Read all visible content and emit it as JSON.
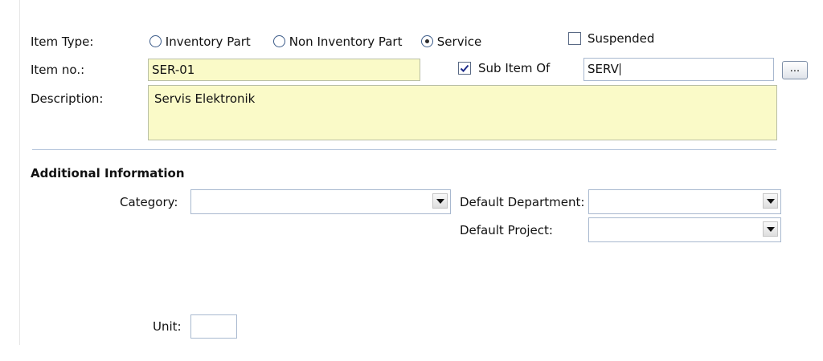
{
  "item_type": {
    "label": "Item Type:",
    "options": [
      {
        "label": "Inventory Part",
        "selected": false
      },
      {
        "label": "Non Inventory Part",
        "selected": false
      },
      {
        "label": "Service",
        "selected": true
      }
    ]
  },
  "suspended": {
    "label": "Suspended",
    "checked": false
  },
  "item_no": {
    "label": "Item no.:",
    "value": "SER-01"
  },
  "sub_item_of": {
    "label": "Sub Item Of",
    "checked": true,
    "value": "SERV",
    "browse_label": "..."
  },
  "description": {
    "label": "Description:",
    "value": "Servis Elektronik"
  },
  "additional_info": {
    "title": "Additional Information",
    "category": {
      "label": "Category:",
      "value": ""
    },
    "default_department": {
      "label": "Default Department:",
      "value": ""
    },
    "default_project": {
      "label": "Default Project:",
      "value": ""
    },
    "unit": {
      "label": "Unit:",
      "value": ""
    }
  },
  "colors": {
    "required_field_bg": "#fafac8",
    "field_border": "#a8b8cf",
    "separator": "#b7c6dc"
  }
}
